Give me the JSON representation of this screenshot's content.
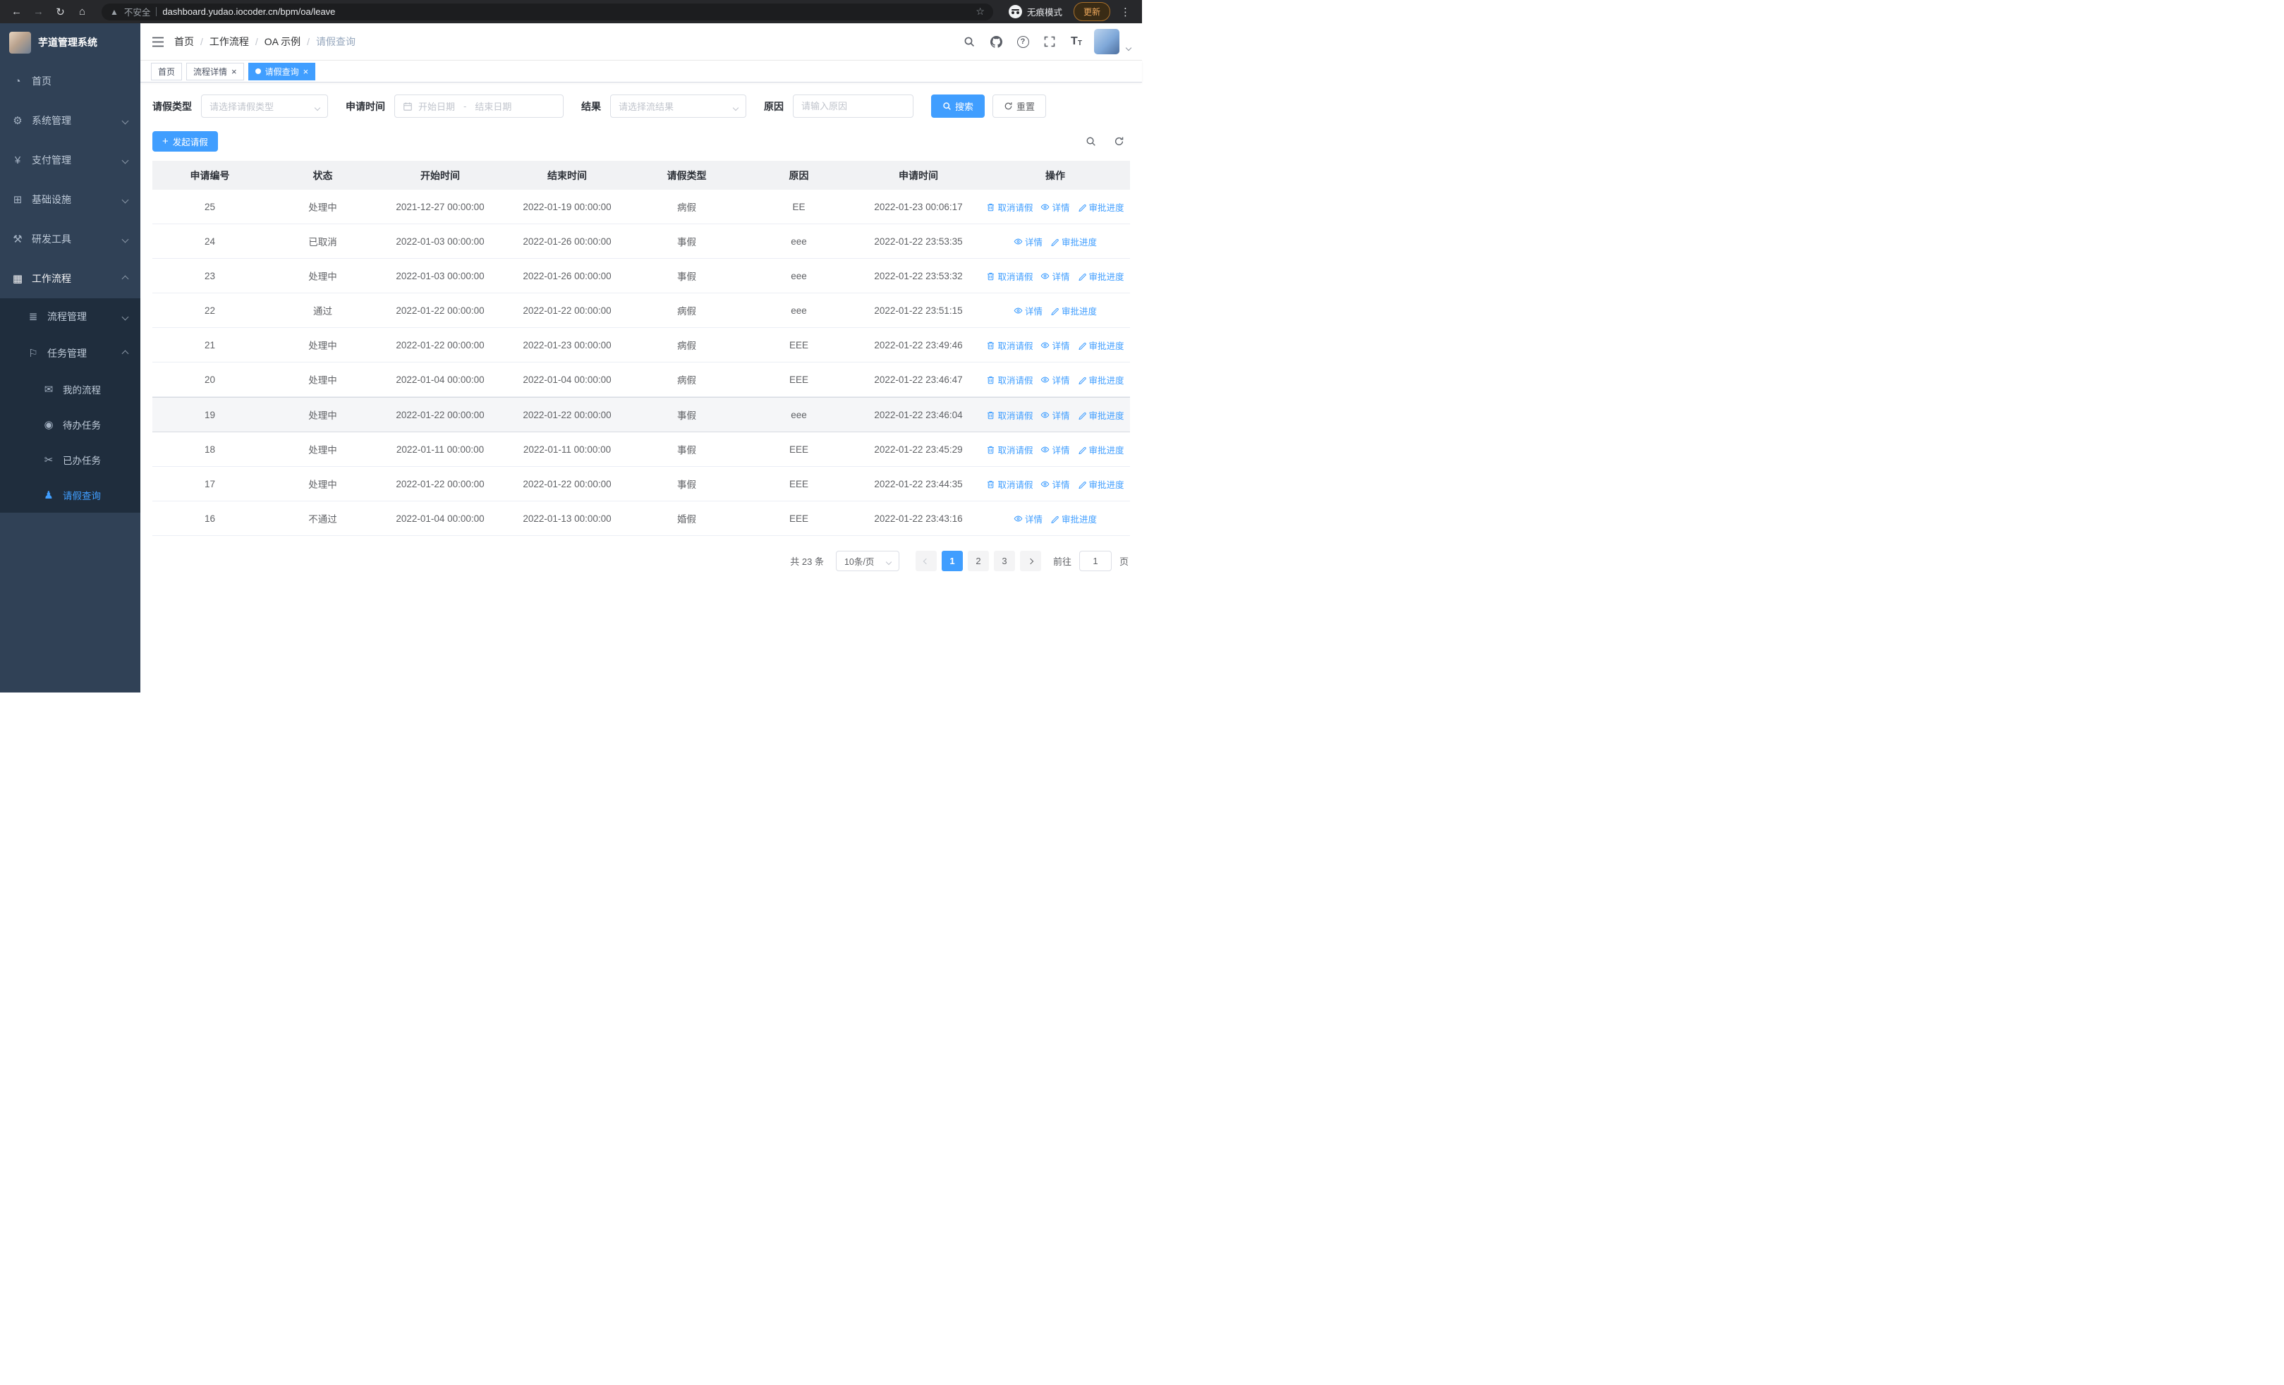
{
  "accent_color": "#409EFF",
  "browser": {
    "security_label": "不安全",
    "url": "dashboard.yudao.iocoder.cn/bpm/oa/leave",
    "incognito_label": "无痕模式",
    "update_label": "更新"
  },
  "sidebar": {
    "app_title": "芋道管理系统",
    "items": [
      {
        "id": "home",
        "label": "首页",
        "icon": "dashboard-icon"
      },
      {
        "id": "system",
        "label": "系统管理",
        "icon": "gear-icon",
        "arrow": "down"
      },
      {
        "id": "pay",
        "label": "支付管理",
        "icon": "yen-icon",
        "arrow": "down"
      },
      {
        "id": "infra",
        "label": "基础设施",
        "icon": "infra-icon",
        "arrow": "down"
      },
      {
        "id": "devtools",
        "label": "研发工具",
        "icon": "tools-icon",
        "arrow": "down"
      },
      {
        "id": "workflow",
        "label": "工作流程",
        "icon": "workflow-icon",
        "arrow": "up",
        "active": true
      }
    ],
    "workflow_children": [
      {
        "id": "process-mgmt",
        "label": "流程管理",
        "icon": "process-icon",
        "arrow": "down",
        "level": 2
      },
      {
        "id": "task-mgmt",
        "label": "任务管理",
        "icon": "task-icon",
        "arrow": "up",
        "level": 2
      },
      {
        "id": "my-process",
        "label": "我的流程",
        "icon": "chat-icon",
        "level": 3
      },
      {
        "id": "todo-task",
        "label": "待办任务",
        "icon": "eye-icon",
        "level": 3
      },
      {
        "id": "done-task",
        "label": "已办任务",
        "icon": "scissors-icon",
        "level": 3
      },
      {
        "id": "leave-query",
        "label": "请假查询",
        "icon": "user-icon",
        "level": 3,
        "active": true
      }
    ]
  },
  "navbar": {
    "breadcrumb": [
      "首页",
      "工作流程",
      "OA 示例",
      "请假查询"
    ]
  },
  "tabs": [
    {
      "id": "home",
      "label": "首页",
      "closable": false,
      "active": false
    },
    {
      "id": "process-detail",
      "label": "流程详情",
      "closable": true,
      "active": false
    },
    {
      "id": "leave-query",
      "label": "请假查询",
      "closable": true,
      "active": true
    }
  ],
  "filters": {
    "leave_type": {
      "label": "请假类型",
      "placeholder": "请选择请假类型"
    },
    "apply_time": {
      "label": "申请时间",
      "start_placeholder": "开始日期",
      "separator": "-",
      "end_placeholder": "结束日期"
    },
    "result": {
      "label": "结果",
      "placeholder": "请选择流结果"
    },
    "reason": {
      "label": "原因",
      "placeholder": "请输入原因"
    },
    "search_label": "搜索",
    "reset_label": "重置"
  },
  "toolbar": {
    "create_label": "发起请假"
  },
  "table": {
    "columns": [
      "申请编号",
      "状态",
      "开始时间",
      "结束时间",
      "请假类型",
      "原因",
      "申请时间",
      "操作"
    ],
    "op_labels": {
      "cancel": "取消请假",
      "detail": "详情",
      "progress": "审批进度"
    },
    "rows": [
      {
        "id": "25",
        "status": "处理中",
        "start": "2021-12-27 00:00:00",
        "end": "2022-01-19 00:00:00",
        "type": "病假",
        "reason": "EE",
        "applied": "2022-01-23 00:06:17",
        "ops": [
          "cancel",
          "detail",
          "progress"
        ],
        "highlighted": false
      },
      {
        "id": "24",
        "status": "已取消",
        "start": "2022-01-03 00:00:00",
        "end": "2022-01-26 00:00:00",
        "type": "事假",
        "reason": "eee",
        "applied": "2022-01-22 23:53:35",
        "ops": [
          "detail",
          "progress"
        ],
        "highlighted": false
      },
      {
        "id": "23",
        "status": "处理中",
        "start": "2022-01-03 00:00:00",
        "end": "2022-01-26 00:00:00",
        "type": "事假",
        "reason": "eee",
        "applied": "2022-01-22 23:53:32",
        "ops": [
          "cancel",
          "detail",
          "progress"
        ],
        "highlighted": false
      },
      {
        "id": "22",
        "status": "通过",
        "start": "2022-01-22 00:00:00",
        "end": "2022-01-22 00:00:00",
        "type": "病假",
        "reason": "eee",
        "applied": "2022-01-22 23:51:15",
        "ops": [
          "detail",
          "progress"
        ],
        "highlighted": false
      },
      {
        "id": "21",
        "status": "处理中",
        "start": "2022-01-22 00:00:00",
        "end": "2022-01-23 00:00:00",
        "type": "病假",
        "reason": "EEE",
        "applied": "2022-01-22 23:49:46",
        "ops": [
          "cancel",
          "detail",
          "progress"
        ],
        "highlighted": false
      },
      {
        "id": "20",
        "status": "处理中",
        "start": "2022-01-04 00:00:00",
        "end": "2022-01-04 00:00:00",
        "type": "病假",
        "reason": "EEE",
        "applied": "2022-01-22 23:46:47",
        "ops": [
          "cancel",
          "detail",
          "progress"
        ],
        "highlighted": false
      },
      {
        "id": "19",
        "status": "处理中",
        "start": "2022-01-22 00:00:00",
        "end": "2022-01-22 00:00:00",
        "type": "事假",
        "reason": "eee",
        "applied": "2022-01-22 23:46:04",
        "ops": [
          "cancel",
          "detail",
          "progress"
        ],
        "highlighted": true
      },
      {
        "id": "18",
        "status": "处理中",
        "start": "2022-01-11 00:00:00",
        "end": "2022-01-11 00:00:00",
        "type": "事假",
        "reason": "EEE",
        "applied": "2022-01-22 23:45:29",
        "ops": [
          "cancel",
          "detail",
          "progress"
        ],
        "highlighted": false
      },
      {
        "id": "17",
        "status": "处理中",
        "start": "2022-01-22 00:00:00",
        "end": "2022-01-22 00:00:00",
        "type": "事假",
        "reason": "EEE",
        "applied": "2022-01-22 23:44:35",
        "ops": [
          "cancel",
          "detail",
          "progress"
        ],
        "highlighted": false
      },
      {
        "id": "16",
        "status": "不通过",
        "start": "2022-01-04 00:00:00",
        "end": "2022-01-13 00:00:00",
        "type": "婚假",
        "reason": "EEE",
        "applied": "2022-01-22 23:43:16",
        "ops": [
          "detail",
          "progress"
        ],
        "highlighted": false
      }
    ]
  },
  "pagination": {
    "total_label": "共 23 条",
    "page_size_label": "10条/页",
    "pages": [
      "1",
      "2",
      "3"
    ],
    "current_page": "1",
    "goto_label": "前往",
    "goto_value": "1",
    "goto_suffix": "页"
  }
}
